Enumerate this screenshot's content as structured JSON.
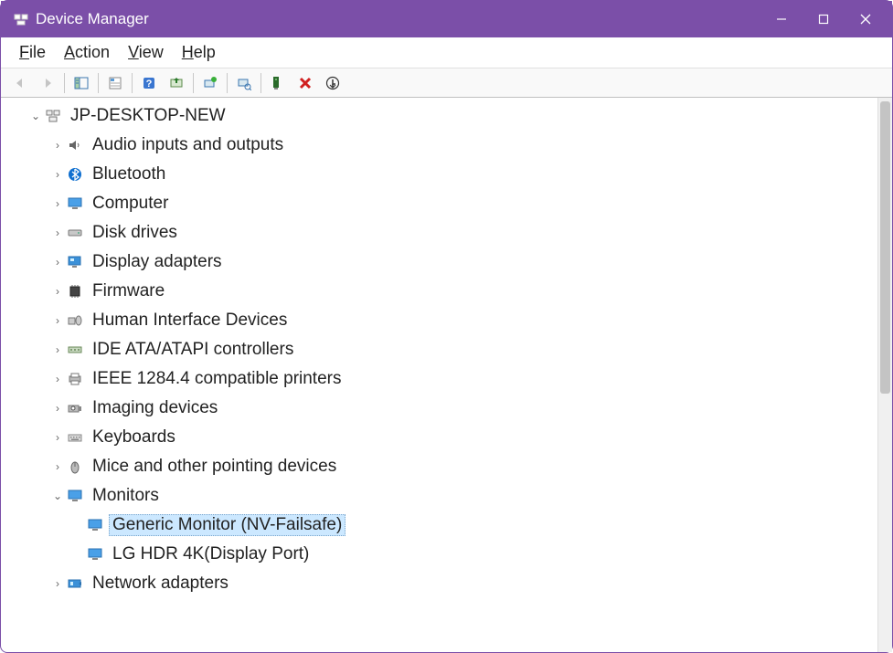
{
  "window": {
    "title": "Device Manager"
  },
  "menu": {
    "file": "File",
    "action": "Action",
    "view": "View",
    "help": "Help"
  },
  "toolbar": {
    "back": "Back",
    "forward": "Forward",
    "show_hide_console_tree": "Show/Hide Console Tree",
    "properties": "Properties",
    "help": "Help",
    "update_driver": "Update Driver",
    "uninstall": "Uninstall",
    "scan": "Scan for hardware changes",
    "add_legacy": "Add Legacy Hardware",
    "disable": "Disable Device",
    "enable": "Enable Device"
  },
  "tree": {
    "root": "JP-DESKTOP-NEW",
    "items": [
      {
        "label": "Audio inputs and outputs",
        "icon": "speaker"
      },
      {
        "label": "Bluetooth",
        "icon": "bluetooth"
      },
      {
        "label": "Computer",
        "icon": "monitor"
      },
      {
        "label": "Disk drives",
        "icon": "disk"
      },
      {
        "label": "Display adapters",
        "icon": "display"
      },
      {
        "label": "Firmware",
        "icon": "chip"
      },
      {
        "label": "Human Interface Devices",
        "icon": "hid"
      },
      {
        "label": "IDE ATA/ATAPI controllers",
        "icon": "ide"
      },
      {
        "label": "IEEE 1284.4 compatible printers",
        "icon": "printer"
      },
      {
        "label": "Imaging devices",
        "icon": "camera"
      },
      {
        "label": "Keyboards",
        "icon": "keyboard"
      },
      {
        "label": "Mice and other pointing devices",
        "icon": "mouse"
      },
      {
        "label": "Monitors",
        "icon": "monitor",
        "expanded": true
      },
      {
        "label": "Network adapters",
        "icon": "network"
      }
    ],
    "monitors_children": [
      {
        "label": "Generic Monitor (NV-Failsafe)",
        "selected": true
      },
      {
        "label": "LG HDR 4K(Display Port)",
        "selected": false
      }
    ]
  }
}
